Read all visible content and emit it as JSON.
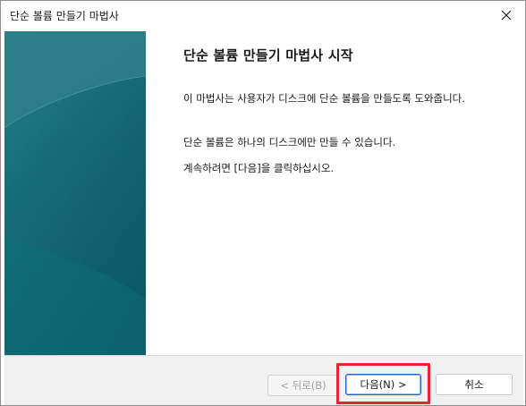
{
  "window": {
    "title": "단순 볼륨 만들기 마법사"
  },
  "content": {
    "heading": "단순 볼륨 만들기 마법사 시작",
    "paragraph1": "이 마법사는 사용자가 디스크에 단순 볼륨을 만들도록 도와줍니다.",
    "paragraph2": "단순 볼륨은 하나의 디스크에만 만들 수 있습니다.",
    "paragraph3": "계속하려면 [다음]을 클릭하십시오."
  },
  "buttons": {
    "back_label": "< 뒤로(B)",
    "next_label": "다음(N) >",
    "cancel_label": "취소"
  },
  "colors": {
    "panel_teal_dark": "#0b5a67",
    "panel_teal_light": "#2a8a93",
    "highlight_red": "#e0282f",
    "focus_blue": "#2663c7"
  },
  "icons": {
    "close": "close-icon"
  }
}
